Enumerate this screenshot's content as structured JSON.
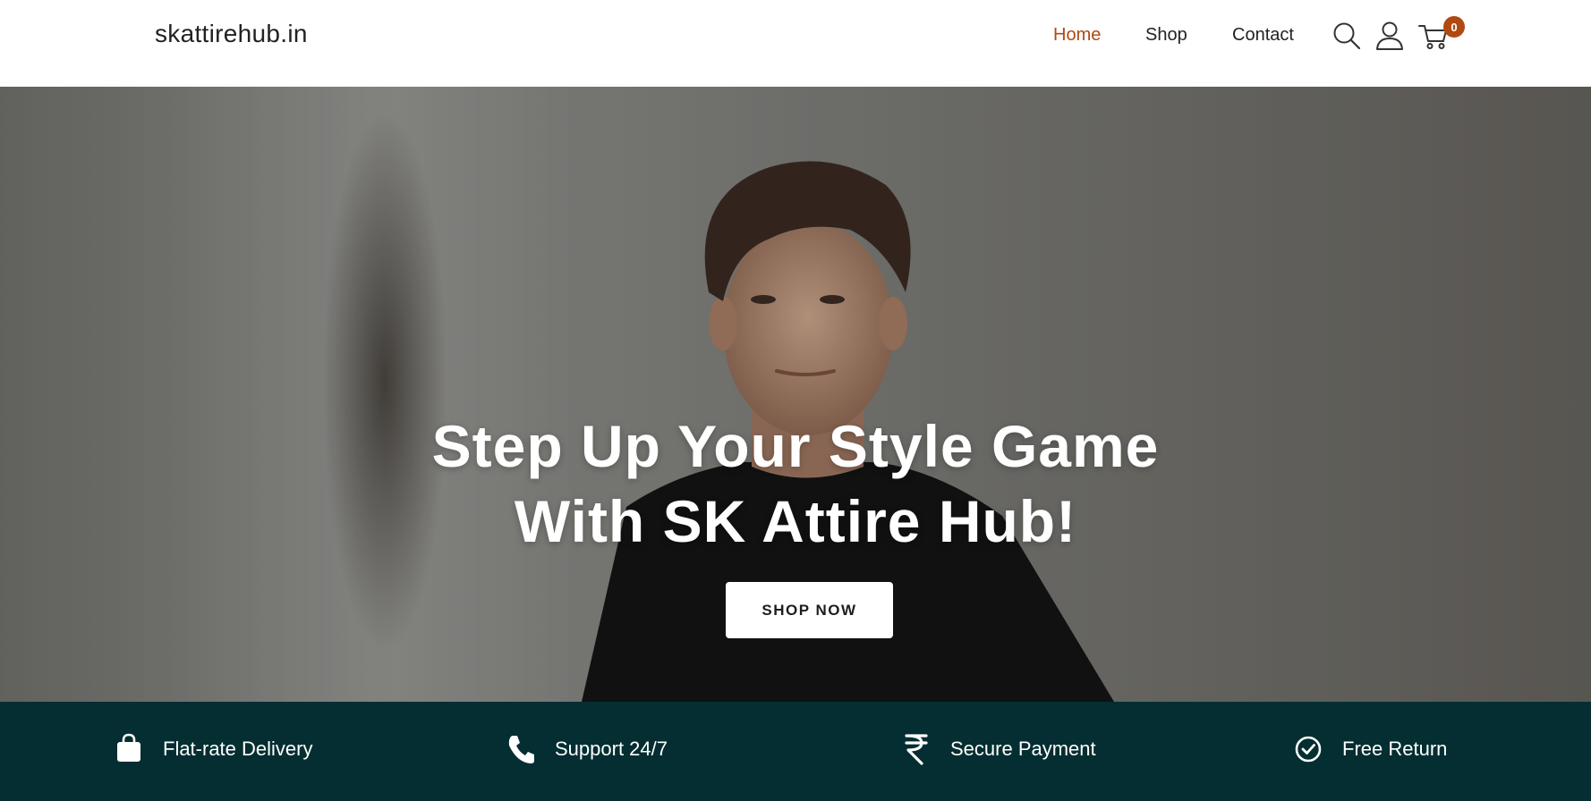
{
  "header": {
    "logo": "skattirehub.in",
    "nav": [
      {
        "label": "Home",
        "active": true
      },
      {
        "label": "Shop",
        "active": false
      },
      {
        "label": "Contact",
        "active": false
      }
    ],
    "icons": [
      "search-icon",
      "user-icon",
      "cart-icon"
    ],
    "cart_count": "0"
  },
  "hero": {
    "title_line1": "Step Up Your Style Game",
    "title_line2": "With SK Attire Hub!",
    "cta_label": "SHOP NOW"
  },
  "features": [
    {
      "icon": "shopping-bag-icon",
      "label": "Flat-rate Delivery"
    },
    {
      "icon": "phone-icon",
      "label": "Support 24/7"
    },
    {
      "icon": "rupee-icon",
      "label": "Secure Payment"
    },
    {
      "icon": "check-circle-icon",
      "label": "Free Return"
    }
  ],
  "colors": {
    "accent": "#b04a12",
    "feature_bar": "#042e31",
    "text": "#222222"
  }
}
